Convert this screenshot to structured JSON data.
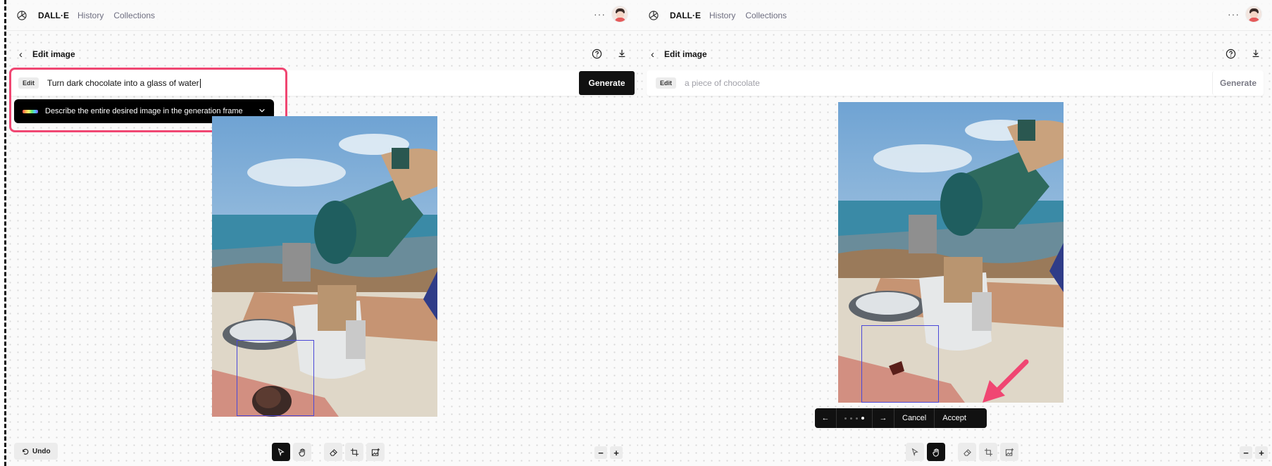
{
  "app": {
    "brand": "DALL·E",
    "nav": [
      "History",
      "Collections"
    ],
    "more_label": "···"
  },
  "editor": {
    "title": "Edit image",
    "back_glyph": "‹"
  },
  "left": {
    "edit_chip": "Edit",
    "prompt_value": "Turn dark chocolate into a glass of water",
    "generate_label": "Generate",
    "hint_text": "Describe the entire desired image in the generation frame",
    "undo_label": "Undo",
    "zoom_out": "−",
    "zoom_in": "+"
  },
  "right": {
    "edit_chip": "Edit",
    "prompt_placeholder": "a piece of chocolate",
    "generate_label": "Generate",
    "variant_prev": "←",
    "variant_next": "→",
    "variant_count": 4,
    "variant_selected": 4,
    "cancel_label": "Cancel",
    "accept_label": "Accept",
    "zoom_out": "−",
    "zoom_in": "+"
  },
  "colors": {
    "highlight": "#f04672",
    "mask": "#4b49d8",
    "dark": "#111111"
  }
}
